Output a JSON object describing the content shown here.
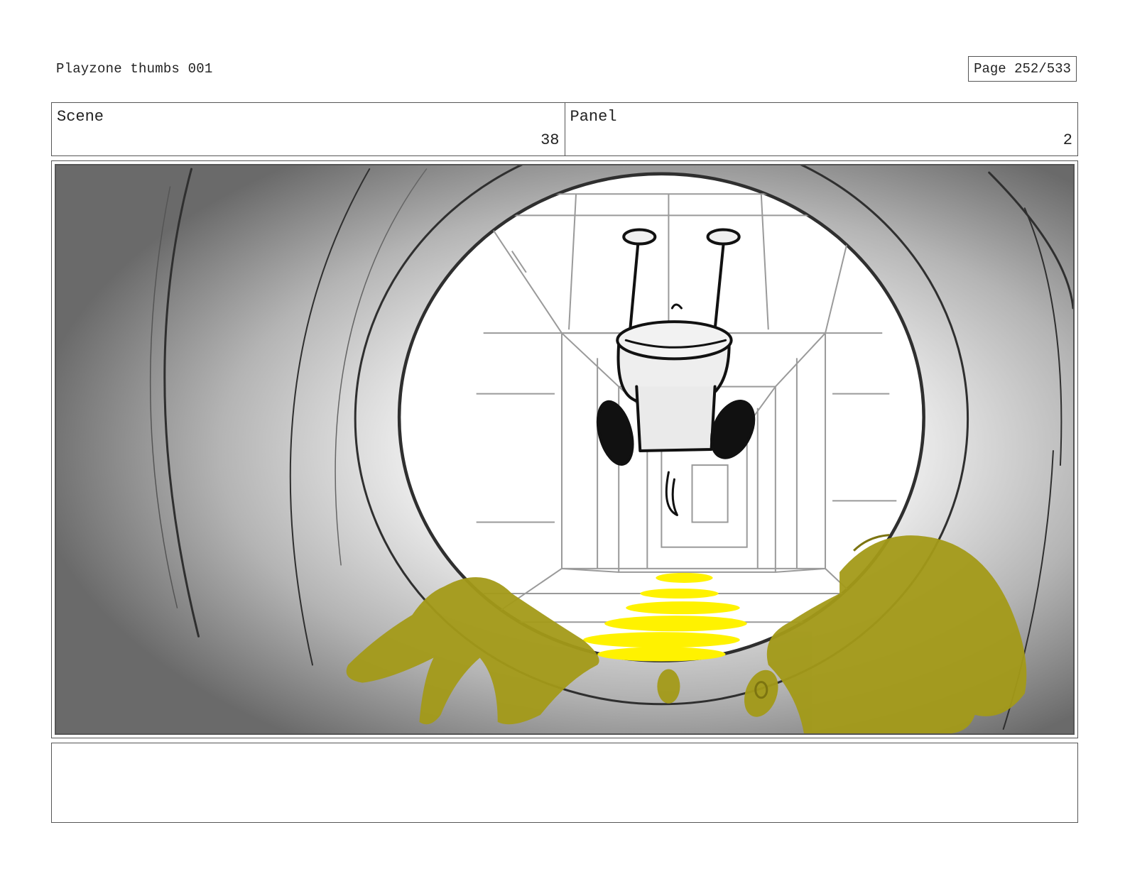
{
  "header": {
    "title": "Playzone thumbs 001",
    "page": "Page 252/533"
  },
  "info": {
    "scene_label": "Scene",
    "scene_value": "38",
    "panel_label": "Panel",
    "panel_value": "2"
  },
  "notes": {
    "text": ""
  },
  "colors": {
    "highlight_yellow": "#fff200",
    "olive_overlay": "#a39a18",
    "frame_border": "#555555"
  }
}
